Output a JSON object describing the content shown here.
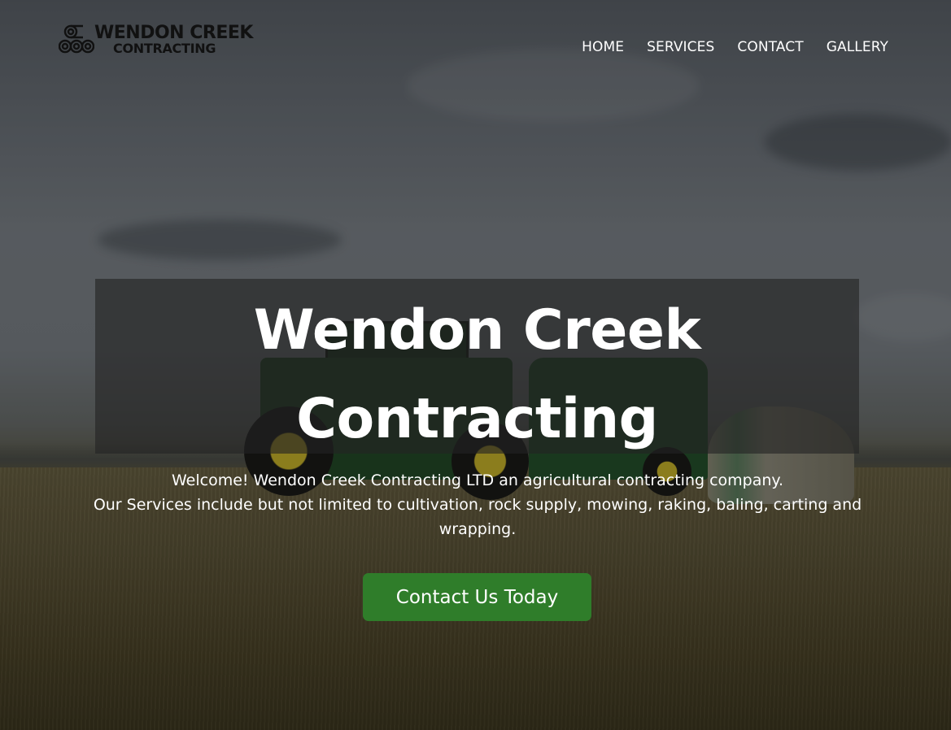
{
  "brand": {
    "name_line1": "WENDON CREEK",
    "name_line2": "CONTRACTING"
  },
  "nav": {
    "items": [
      {
        "label": "HOME"
      },
      {
        "label": "SERVICES"
      },
      {
        "label": "CONTACT"
      },
      {
        "label": "GALLERY"
      }
    ]
  },
  "hero": {
    "title_line1": "Wendon Creek",
    "title_line2": "Contracting",
    "description_line1": "Welcome! Wendon Creek Contracting LTD an agricultural contracting company.",
    "description_line2": "Our Services include but not limited to cultivation, rock supply, mowing, raking, baling, carting and wrapping.",
    "cta_label": "Contact Us Today"
  },
  "colors": {
    "cta_background": "#2f7d2a",
    "nav_text": "#ffffff",
    "title_panel": "rgba(35,35,35,0.62)"
  }
}
